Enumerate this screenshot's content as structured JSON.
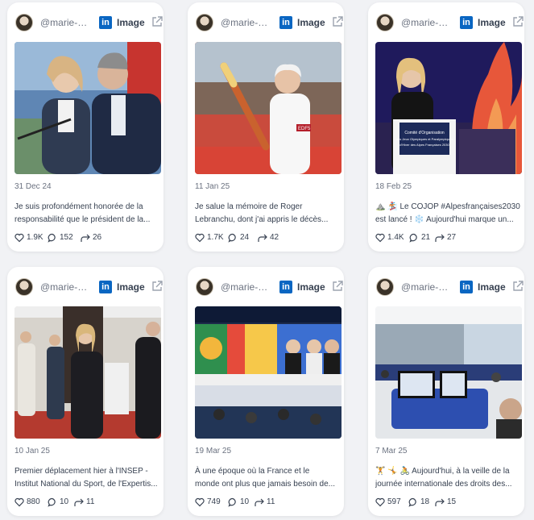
{
  "posts": [
    {
      "handle": "@marie-ba...",
      "type": "Image",
      "date": "31 Dec 24",
      "line1": "Je suis profondément honorée de la",
      "line2": "responsabilité que le président de la...",
      "likes": "1.9K",
      "comments": "152",
      "shares": "26",
      "image_text": ""
    },
    {
      "handle": "@marie-ba...",
      "type": "Image",
      "date": "11 Jan 25",
      "line1": "Je salue la mémoire de Roger",
      "line2": "Lebranchu, dont j'ai appris le décès...",
      "likes": "1.7K",
      "comments": "24",
      "shares": "42",
      "image_text": "EDF5"
    },
    {
      "handle": "@marie-ba...",
      "type": "Image",
      "date": "18 Feb 25",
      "line1": "⛰️ 🏂 Le COJOP #Alpesfrançaises2030",
      "line2": "est lancé ! ❄️ Aujourd'hui marque un...",
      "likes": "1.4K",
      "comments": "21",
      "shares": "27",
      "image_text": "Comité d'Organisation des Jeux Olympiques et Paralympiques d'Hiver des Alpes Françaises 2030"
    },
    {
      "handle": "@marie-ba...",
      "type": "Image",
      "date": "10 Jan 25",
      "line1": "Premier déplacement hier à l'INSEP -",
      "line2": "Institut National du Sport, de l'Expertis...",
      "likes": "880",
      "comments": "10",
      "shares": "11",
      "image_text": ""
    },
    {
      "handle": "@marie-ba...",
      "type": "Image",
      "date": "19 Mar 25",
      "line1": "À une époque où la France et le",
      "line2": "monde ont plus que jamais besoin de...",
      "likes": "749",
      "comments": "10",
      "shares": "11",
      "image_text": ""
    },
    {
      "handle": "@marie-ba...",
      "type": "Image",
      "date": "7 Mar 25",
      "line1": "🏋️ 🤸 🚴 Aujourd'hui, à la veille de la",
      "line2": "journée internationale des droits des...",
      "likes": "597",
      "comments": "18",
      "shares": "15",
      "image_text": ""
    }
  ],
  "colors": {
    "linkedin": "#0a66c2",
    "text": "#374151",
    "muted": "#6b7280"
  },
  "icons": {
    "network": "linkedin-icon",
    "external": "external-link-icon",
    "like": "heart-icon",
    "comment": "comment-icon",
    "share": "share-icon"
  }
}
